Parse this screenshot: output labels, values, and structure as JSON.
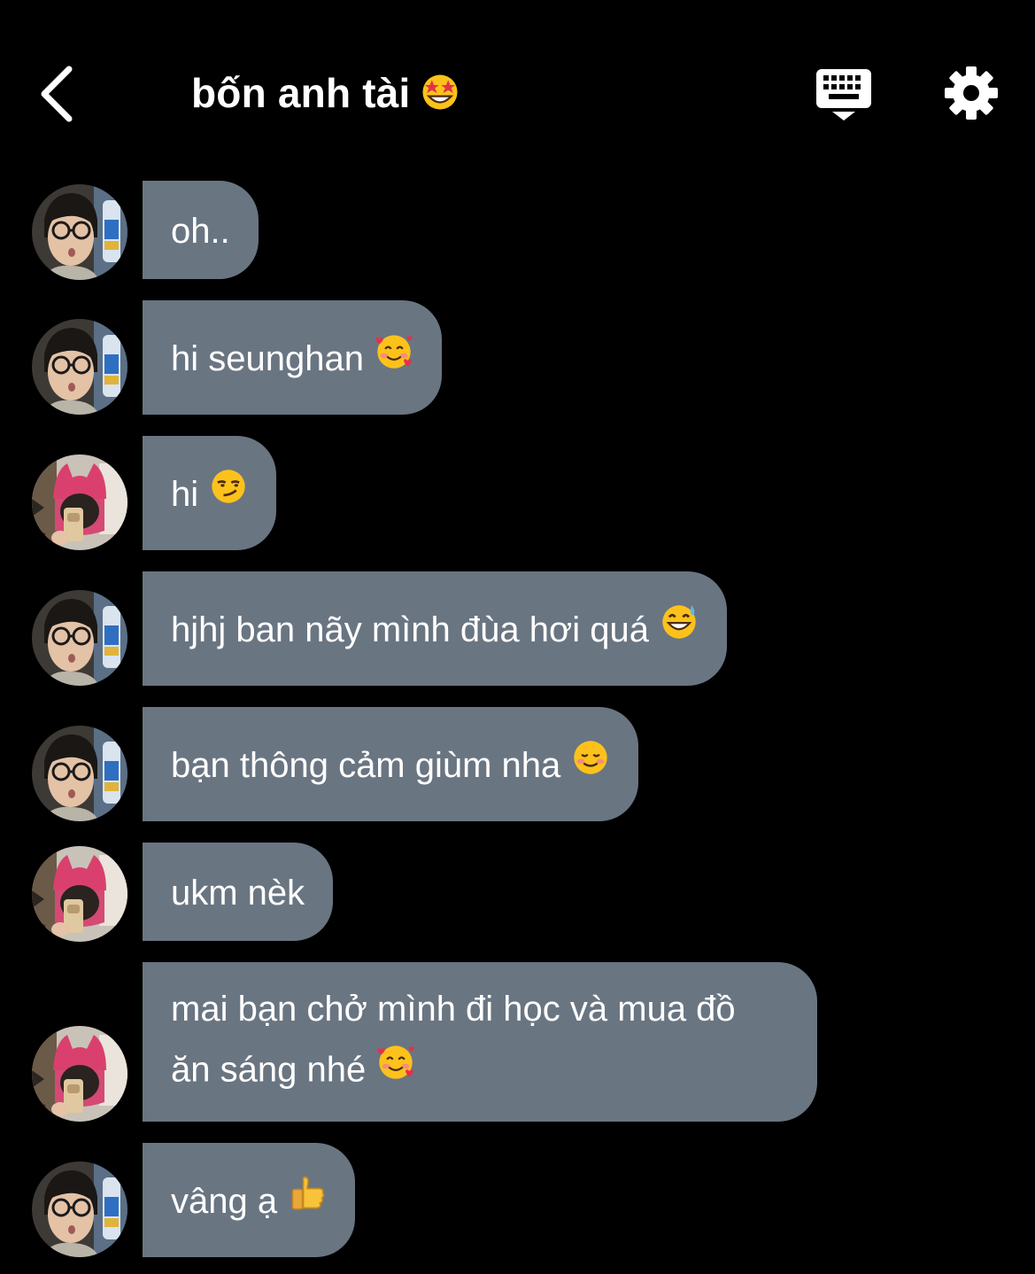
{
  "header": {
    "title": "bốn anh tài",
    "title_emoji": "star-struck-emoji",
    "back_icon": "chevron-left-icon",
    "keyboard_icon": "keyboard-icon",
    "settings_icon": "gear-icon"
  },
  "colors": {
    "background": "#000000",
    "bubble": "#6a7582",
    "text": "#ffffff"
  },
  "messages": [
    {
      "sender": "glasses-avatar",
      "text": "oh..",
      "emoji": ""
    },
    {
      "sender": "glasses-avatar",
      "text": "hi seunghan",
      "emoji": "smiling-face-with-hearts-emoji"
    },
    {
      "sender": "pink-hat-avatar",
      "text": "hi",
      "emoji": "smirking-face-emoji"
    },
    {
      "sender": "glasses-avatar",
      "text": "hjhj ban nãy mình đùa hơi quá",
      "emoji": "grinning-face-with-sweat-emoji"
    },
    {
      "sender": "glasses-avatar",
      "text": "bạn thông cảm giùm nha",
      "emoji": "smiling-face-emoji"
    },
    {
      "sender": "pink-hat-avatar",
      "text": "ukm nèk",
      "emoji": ""
    },
    {
      "sender": "pink-hat-avatar",
      "text_line1": "mai bạn chở mình đi học và mua đồ",
      "text_line2": "ăn sáng nhé",
      "emoji": "smiling-face-with-hearts-emoji"
    },
    {
      "sender": "glasses-avatar",
      "text": "vâng ạ",
      "emoji": "thumbs-up-emoji"
    }
  ]
}
